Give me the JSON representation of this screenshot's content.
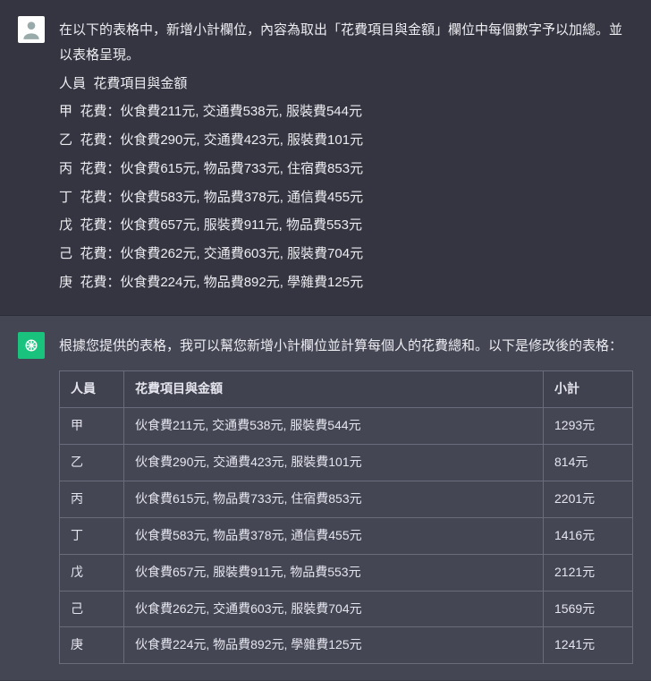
{
  "user_message": {
    "lines": [
      "在以下的表格中，新增小計欄位，內容為取出「花費項目與金額」欄位中每個數字予以加總。並以表格呈現。",
      "人員  花費項目與金額",
      "甲  花費：伙食費211元, 交通費538元, 服裝費544元",
      "乙  花費：伙食費290元, 交通費423元, 服裝費101元",
      "丙  花費：伙食費615元, 物品費733元, 住宿費853元",
      "丁  花費：伙食費583元, 物品費378元, 通信費455元",
      "戊  花費：伙食費657元, 服裝費911元, 物品費553元",
      "己  花費：伙食費262元, 交通費603元, 服裝費704元",
      "庚  花費：伙食費224元, 物品費892元, 學雜費125元"
    ]
  },
  "assistant_message": {
    "intro": "根據您提供的表格，我可以幫您新增小計欄位並計算每個人的花費總和。以下是修改後的表格：",
    "table": {
      "headers": {
        "person": "人員",
        "items": "花費項目與金額",
        "subtotal": "小計"
      },
      "rows": [
        {
          "person": "甲",
          "items": "伙食費211元, 交通費538元, 服裝費544元",
          "subtotal": "1293元"
        },
        {
          "person": "乙",
          "items": "伙食費290元, 交通費423元, 服裝費101元",
          "subtotal": "814元"
        },
        {
          "person": "丙",
          "items": "伙食費615元, 物品費733元, 住宿費853元",
          "subtotal": "2201元"
        },
        {
          "person": "丁",
          "items": "伙食費583元, 物品費378元, 通信費455元",
          "subtotal": "1416元"
        },
        {
          "person": "戊",
          "items": "伙食費657元, 服裝費911元, 物品費553元",
          "subtotal": "2121元"
        },
        {
          "person": "己",
          "items": "伙食費262元, 交通費603元, 服裝費704元",
          "subtotal": "1569元"
        },
        {
          "person": "庚",
          "items": "伙食費224元, 物品費892元, 學雜費125元",
          "subtotal": "1241元"
        }
      ]
    }
  }
}
